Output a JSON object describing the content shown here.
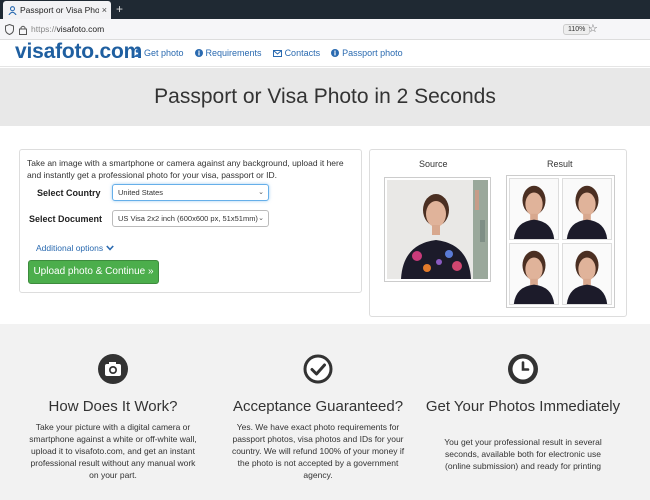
{
  "browser": {
    "tab_title": "Passport or Visa Photo in ...",
    "tab_close": "×",
    "new_tab": "+",
    "url_protocol": "https://",
    "url_host": "visafoto.com",
    "zoom": "110%",
    "star": "☆"
  },
  "site": {
    "logo": "visafoto.com",
    "menu": [
      {
        "label": "Get photo",
        "icon": "person-icon"
      },
      {
        "label": "Requirements",
        "icon": "info-icon"
      },
      {
        "label": "Contacts",
        "icon": "envelope-icon"
      },
      {
        "label": "Passport photo",
        "icon": "info-icon"
      }
    ],
    "accent": "#2a6ab0",
    "logo_color": "#1f5fa0"
  },
  "hero": {
    "title": "Passport or Visa Photo in 2 Seconds"
  },
  "upload": {
    "intro": "Take an image with a smartphone or camera against any background, upload it here and instantly get a professional photo for your visa, passport or ID.",
    "country_label": "Select Country",
    "country_value": "United States",
    "document_label": "Select Document",
    "document_value": "US Visa 2x2 inch (600x600 px, 51x51mm)",
    "additional_options": "Additional options",
    "button": "Upload photo & Continue »",
    "button_color": "#4cae4c"
  },
  "preview": {
    "source_label": "Source",
    "result_label": "Result"
  },
  "features": [
    {
      "icon": "camera-icon",
      "title": "How Does It Work?",
      "desc": "Take your picture with a digital camera or smartphone against a white or off-white wall, upload it to visafoto.com, and get an instant professional result without any manual work on your part."
    },
    {
      "icon": "checkmark-icon",
      "title": "Acceptance Guaranteed?",
      "desc": "Yes. We have exact photo requirements for passport photos, visa photos and IDs for your country. We will refund 100% of your money if the photo is not accepted by a government agency."
    },
    {
      "icon": "clock-icon",
      "title": "Get Your Photos Immediately",
      "desc": "You get your professional result in several seconds, available both for electronic use (online submission) and ready for printing"
    }
  ]
}
